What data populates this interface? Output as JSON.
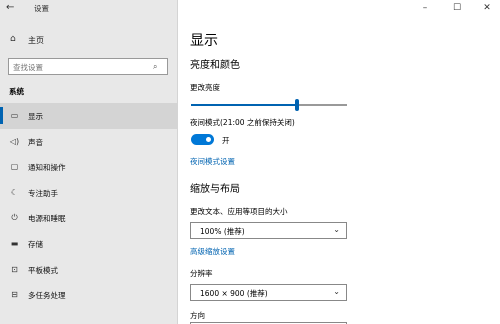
{
  "window": {
    "title": "设置",
    "back_icon": "←",
    "minimize_icon": "–",
    "maximize_icon": "☐",
    "close_icon": "✕"
  },
  "sidebar": {
    "home": {
      "label": "主页",
      "icon": "⌂"
    },
    "search": {
      "placeholder": "查找设置",
      "icon": "⌕"
    },
    "section_label": "系统",
    "items": [
      {
        "label": "显示",
        "icon": "▭",
        "active": true
      },
      {
        "label": "声音",
        "icon": "◁)",
        "active": false
      },
      {
        "label": "通知和操作",
        "icon": "▢",
        "active": false
      },
      {
        "label": "专注助手",
        "icon": "☾",
        "active": false
      },
      {
        "label": "电源和睡眠",
        "icon": "⏻",
        "active": false
      },
      {
        "label": "存储",
        "icon": "▬",
        "active": false
      },
      {
        "label": "平板模式",
        "icon": "⊡",
        "active": false
      },
      {
        "label": "多任务处理",
        "icon": "⊟",
        "active": false
      }
    ]
  },
  "main": {
    "title": "显示",
    "brightness_section": "亮度和颜色",
    "brightness_label": "更改亮度",
    "brightness_value": 0.68,
    "night_light_label": "夜间模式(21:00 之前保持关闭)",
    "night_light_toggle": "开",
    "night_light_link": "夜间模式设置",
    "scale_section": "缩放与布局",
    "scale_label": "更改文本、应用等项目的大小",
    "scale_value": "100% (推荐)",
    "advanced_scale_link": "高级缩放设置",
    "resolution_label": "分辨率",
    "resolution_value": "1600 × 900 (推荐)",
    "orientation_label": "方向",
    "chevron_icon": "⌄"
  },
  "colors": {
    "accent": "#0063b1",
    "toggle_on": "#0078d7",
    "sidebar_bg": "#e8e8e8"
  }
}
